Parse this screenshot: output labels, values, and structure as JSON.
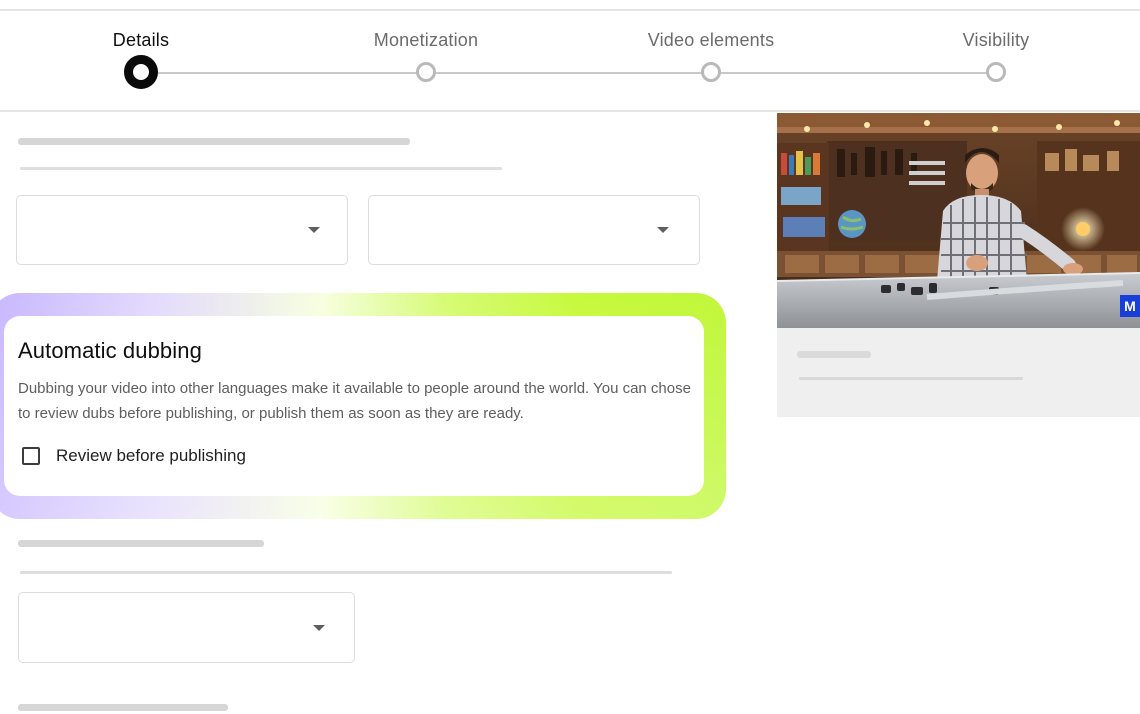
{
  "stepper": {
    "steps": [
      {
        "label": "Details"
      },
      {
        "label": "Monetization"
      },
      {
        "label": "Video elements"
      },
      {
        "label": "Visibility"
      }
    ],
    "active_step": "Details"
  },
  "dubbing": {
    "title": "Automatic dubbing",
    "description": "Dubbing your video into other languages make it available to people around the world. You can chose to review dubs before publishing, or publish them as soon as they are ready.",
    "checkbox_label": "Review before publishing",
    "checkbox_checked": false
  },
  "thumbnail": {
    "badge_text": "M"
  },
  "colors": {
    "glow_start": "#c7b6ff",
    "glow_end": "#c0f73a",
    "active_step": "#0a0a0a",
    "inactive_step": "#b9b9b9"
  }
}
